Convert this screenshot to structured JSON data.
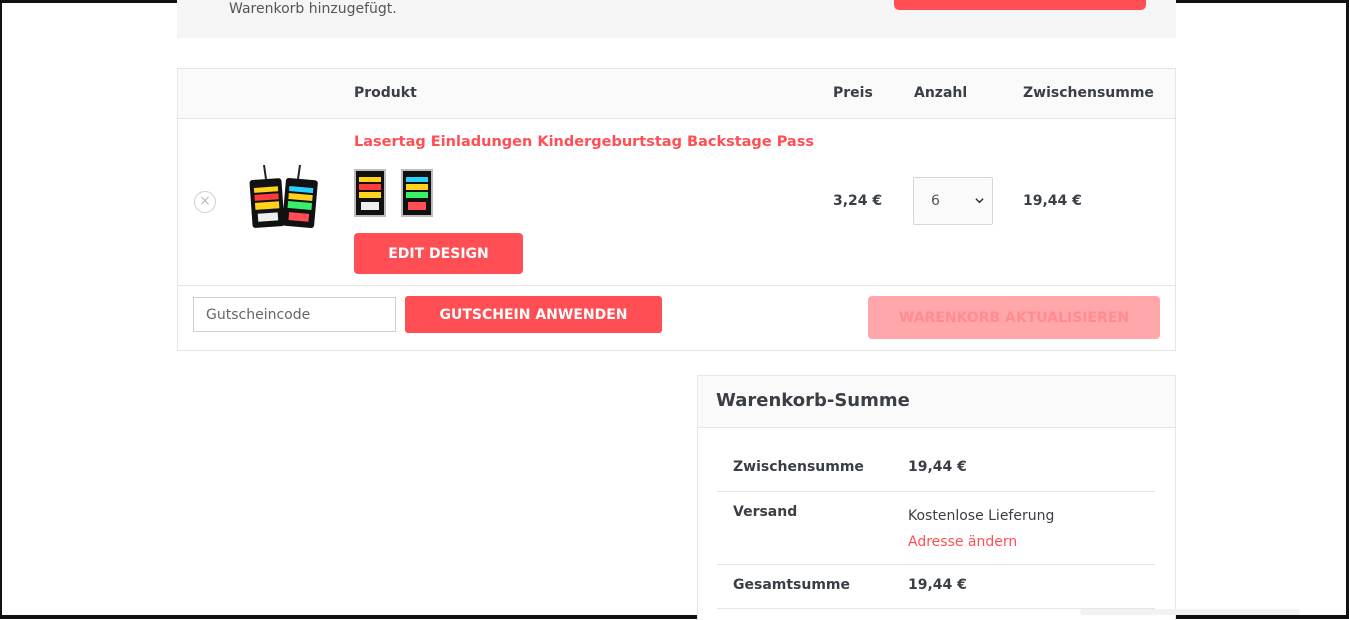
{
  "notice": {
    "text": "Warenkorb hinzugefügt."
  },
  "cart": {
    "headers": {
      "product": "Produkt",
      "price": "Preis",
      "quantity": "Anzahl",
      "subtotal": "Zwischensumme"
    },
    "items": [
      {
        "remove_symbol": "×",
        "name": "Lasertag Einladungen Kindergeburtstag Backstage Pass",
        "edit_label": "EDIT DESIGN",
        "price": "3,24 €",
        "quantity": "6",
        "subtotal": "19,44 €"
      }
    ],
    "coupon": {
      "placeholder": "Gutscheincode",
      "apply_label": "GUTSCHEIN ANWENDEN"
    },
    "update_label": "WARENKORB AKTUALISIEREN"
  },
  "totals": {
    "title": "Warenkorb-Summe",
    "subtotal_label": "Zwischensumme",
    "subtotal_value": "19,44 €",
    "shipping_label": "Versand",
    "shipping_value": "Kostenlose Lieferung",
    "change_address": "Adresse ändern",
    "total_label": "Gesamtsumme",
    "total_value": "19,44 €"
  },
  "colors": {
    "accent": "#ff4f55",
    "accent_disabled": "#ffa7aa",
    "border": "#e6e6e6"
  },
  "icons": {
    "remove": "close-circle-icon",
    "select_arrow": "chevron-down-icon"
  }
}
